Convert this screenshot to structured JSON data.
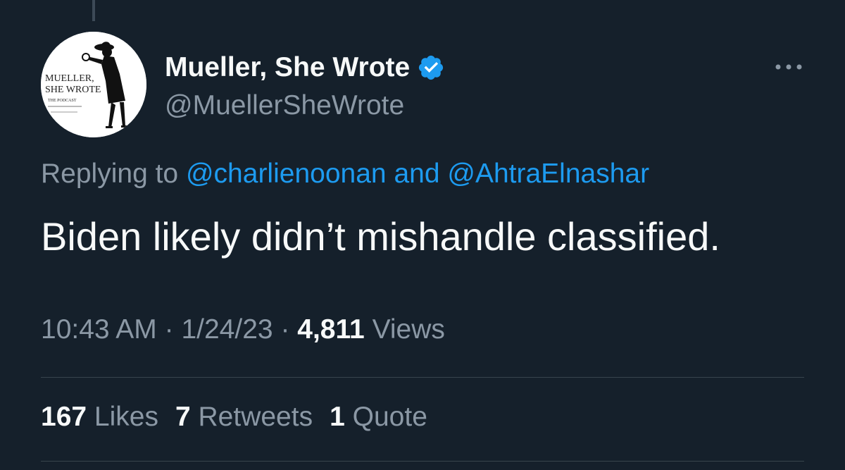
{
  "tweet": {
    "author": {
      "display_name": "Mueller, She Wrote",
      "handle": "@MuellerSheWrote",
      "verified": true,
      "avatar": {
        "line1": "MUELLER,",
        "line2": "SHE WROTE",
        "line3": "THE PODCAST"
      }
    },
    "replying": {
      "prefix": "Replying to",
      "mention1": "@charlienoonan",
      "conjunction": "and",
      "mention2": "@AhtraElnashar"
    },
    "text": "Biden likely didn’t mishandle classified.",
    "meta": {
      "time": "10:43 AM",
      "separator": "·",
      "date": "1/24/23",
      "views_count": "4,811",
      "views_label": "Views"
    },
    "stats": {
      "likes_count": "167",
      "likes_label": "Likes",
      "retweets_count": "7",
      "retweets_label": "Retweets",
      "quotes_count": "1",
      "quotes_label": "Quote"
    }
  },
  "icons": {
    "more": "more-horizontal-icon",
    "verified": "verified-badge-icon"
  },
  "colors": {
    "background": "#15202b",
    "primary_text": "#f7f9f9",
    "secondary_text": "#8b98a5",
    "accent": "#1d9bf0",
    "divider": "#38444d"
  }
}
